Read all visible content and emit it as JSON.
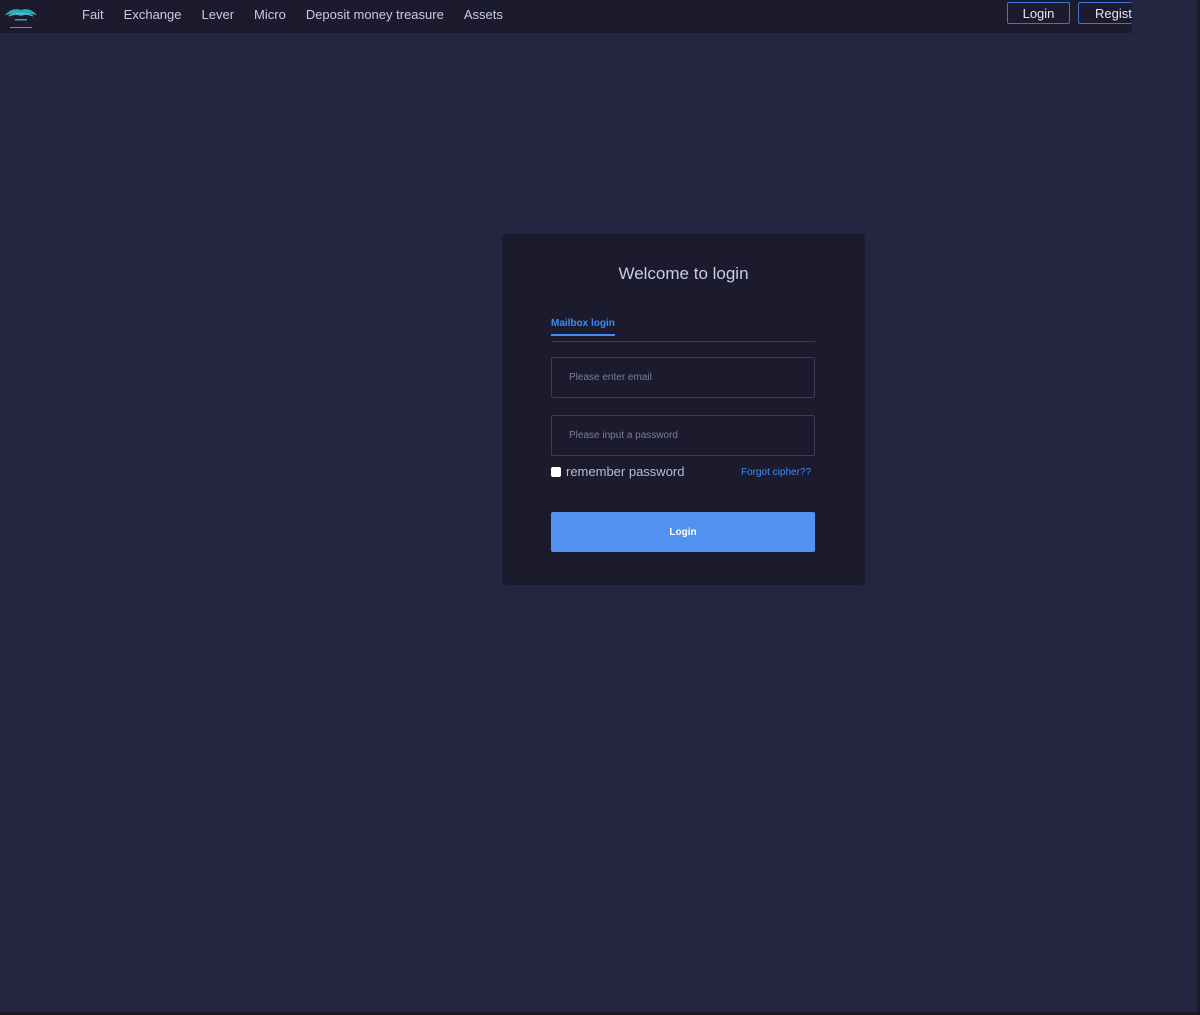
{
  "nav": {
    "logo_icon": "brand-logo",
    "links": [
      "Fait",
      "Exchange",
      "Lever",
      "Micro",
      "Deposit money treasure",
      "Assets"
    ],
    "login_label": "Login",
    "register_label": "Register"
  },
  "login_card": {
    "title": "Welcome to login",
    "tab_label": "Mailbox login",
    "email_placeholder": "Please enter email",
    "password_placeholder": "Please input a password",
    "remember_label": "remember password",
    "forgot_label": "Forgot cipher??",
    "submit_label": "Login"
  },
  "colors": {
    "page_bg": "#262541",
    "nav_bg": "#1b1b2d",
    "card_bg": "#1b1b2d",
    "accent": "#3f8cf5",
    "button": "#5191f2"
  }
}
